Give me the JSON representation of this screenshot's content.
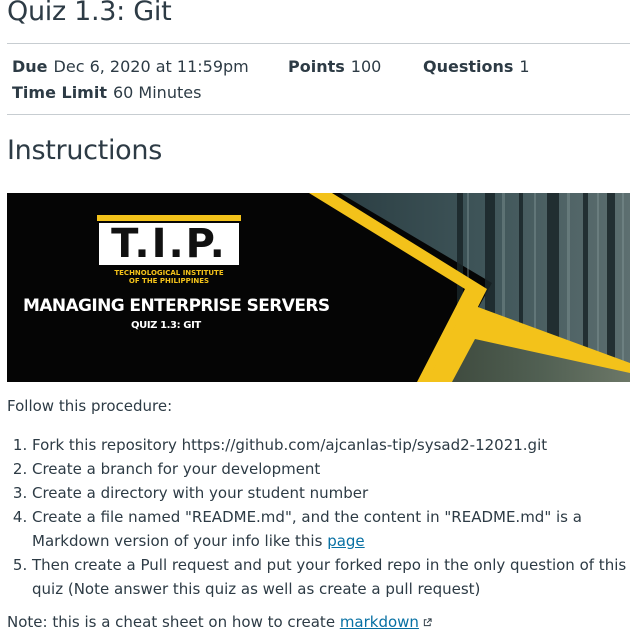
{
  "quiz": {
    "title": "Quiz 1.3: Git",
    "details": {
      "due_label": "Due",
      "due_value": "Dec 6, 2020 at 11:59pm",
      "points_label": "Points",
      "points_value": "100",
      "questions_label": "Questions",
      "questions_value": "1",
      "time_limit_label": "Time Limit",
      "time_limit_value": "60 Minutes"
    }
  },
  "instructions": {
    "heading": "Instructions",
    "banner": {
      "logo_text": "T.I.P.",
      "institute_line1": "TECHNOLOGICAL INSTITUTE",
      "institute_line2": "OF THE PHILIPPINES",
      "course": "MANAGING ENTERPRISE SERVERS",
      "quiz": "QUIZ 1.3: GIT",
      "accent_color": "#f3c21a"
    },
    "intro": "Follow this procedure:",
    "steps": [
      {
        "text": "Fork this repository https://github.com/ajcanlas-tip/sysad2-12021.git"
      },
      {
        "text": "Create a branch for your development"
      },
      {
        "text": "Create a directory with your student number"
      },
      {
        "text": "Create a file named \"README.md\", and the content in \"README.md\" is a Markdown version of your info like this ",
        "link": "page"
      },
      {
        "text": "Then create a Pull request and put your forked repo in the only question of this quiz (Note answer this quiz as well as create a pull request)"
      }
    ],
    "note_text": "Note: this is a cheat sheet on how to create ",
    "note_link": "markdown",
    "note_link_icon": "external-link-icon",
    "link_color": "#0770a3"
  }
}
